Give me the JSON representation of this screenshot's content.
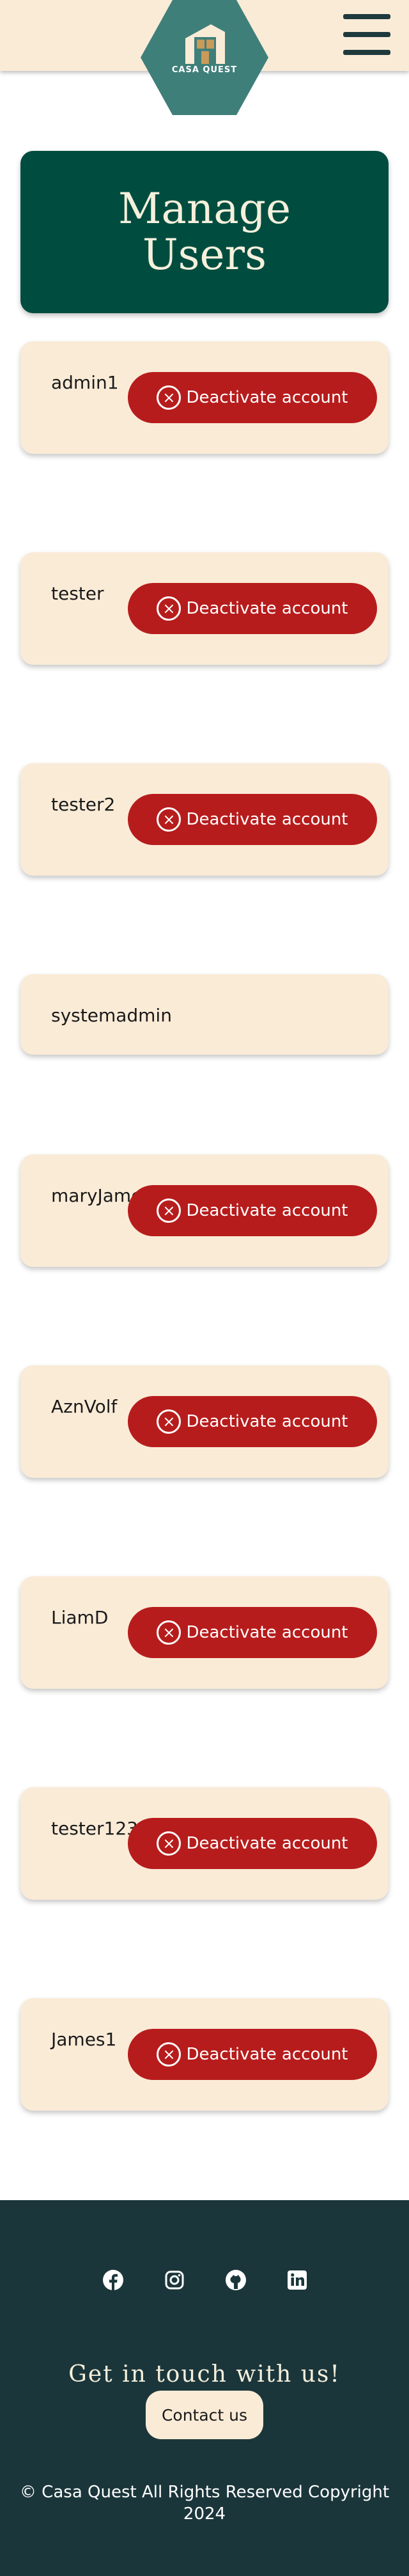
{
  "header": {
    "logo_text": "CASA QUEST",
    "menu_icon": "hamburger-menu-icon",
    "colors": {
      "bg": "#faebd7",
      "logo": "#3f7f7a"
    }
  },
  "main": {
    "title": "Manage Users",
    "deactivate_label": "Deactivate account",
    "users": [
      {
        "username": "admin1",
        "can_deactivate": true
      },
      {
        "username": "tester",
        "can_deactivate": true
      },
      {
        "username": "tester2",
        "can_deactivate": true
      },
      {
        "username": "systemadmin",
        "can_deactivate": false
      },
      {
        "username": "maryJames",
        "can_deactivate": true
      },
      {
        "username": "AznVolf",
        "can_deactivate": true
      },
      {
        "username": "LiamD",
        "can_deactivate": true
      },
      {
        "username": "tester123",
        "can_deactivate": true
      },
      {
        "username": "James1",
        "can_deactivate": true
      }
    ],
    "colors": {
      "title_bg": "#004d40",
      "card_bg": "#faebd7",
      "button_bg": "#b71c1c"
    }
  },
  "footer": {
    "social_icons": [
      "facebook-icon",
      "instagram-icon",
      "github-icon",
      "linkedin-icon"
    ],
    "heading": "Get in touch with us!",
    "contact_label": "Contact us",
    "copyright": "© Casa Quest All Rights Reserved Copyright 2024",
    "colors": {
      "bg": "#1b363b"
    }
  }
}
